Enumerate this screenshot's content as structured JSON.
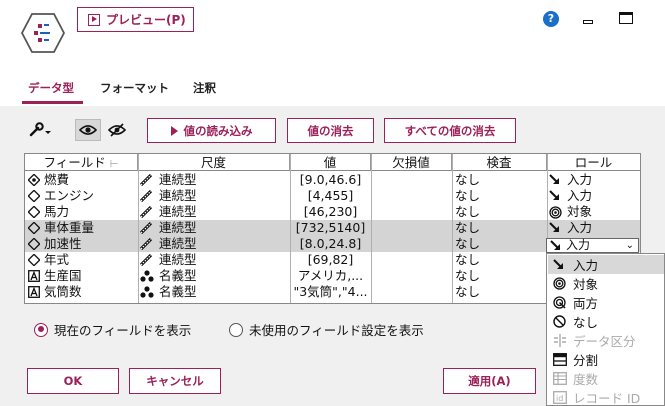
{
  "header": {
    "preview_label": "プレビュー(P)",
    "help_icon": "?"
  },
  "tabs": [
    {
      "label": "データ型",
      "active": true
    },
    {
      "label": "フォーマット",
      "active": false
    },
    {
      "label": "注釈",
      "active": false
    }
  ],
  "toolbar": {
    "read_values": "値の読み込み",
    "clear_values": "値の消去",
    "clear_all_values": "すべての値の消去"
  },
  "table": {
    "headers": [
      "フィールド",
      "尺度",
      "値",
      "欠損値",
      "検査",
      "ロール"
    ],
    "rows": [
      {
        "field": "燃費",
        "field_icon": "target-diamond-icon",
        "measure": "連続型",
        "value": "[9.0,46.6]",
        "missing": "",
        "check": "なし",
        "role": "入力"
      },
      {
        "field": "エンジン",
        "field_icon": "diamond-icon",
        "measure": "連続型",
        "value": "[4,455]",
        "missing": "",
        "check": "なし",
        "role": "入力"
      },
      {
        "field": "馬力",
        "field_icon": "diamond-icon",
        "measure": "連続型",
        "value": "[46,230]",
        "missing": "",
        "check": "なし",
        "role": "対象"
      },
      {
        "field": "車体重量",
        "field_icon": "diamond-icon",
        "measure": "連続型",
        "value": "[732,5140]",
        "missing": "",
        "check": "なし",
        "role": "入力"
      },
      {
        "field": "加速性",
        "field_icon": "diamond-icon",
        "measure": "連続型",
        "value": "[8.0,24.8]",
        "missing": "",
        "check": "なし",
        "role": "入力"
      },
      {
        "field": "年式",
        "field_icon": "diamond-icon",
        "measure": "連続型",
        "value": "[69,82]",
        "missing": "",
        "check": "なし",
        "role": ""
      },
      {
        "field": "生産国",
        "field_icon": "text-a-icon",
        "measure": "名義型",
        "value": "アメリカ,...",
        "missing": "",
        "check": "なし",
        "role": ""
      },
      {
        "field": "気筒数",
        "field_icon": "text-a-icon",
        "measure": "名義型",
        "value": "\"3気筒\",\"4...",
        "missing": "",
        "check": "なし",
        "role": ""
      }
    ]
  },
  "role_select": {
    "value": "入力"
  },
  "role_options": [
    {
      "label": "入力",
      "icon": "input-arrow-icon",
      "disabled": false
    },
    {
      "label": "対象",
      "icon": "target-icon",
      "disabled": false
    },
    {
      "label": "両方",
      "icon": "both-icon",
      "disabled": false
    },
    {
      "label": "なし",
      "icon": "none-icon",
      "disabled": false
    },
    {
      "label": "データ区分",
      "icon": "partition-icon",
      "disabled": true
    },
    {
      "label": "分割",
      "icon": "split-icon",
      "disabled": false
    },
    {
      "label": "度数",
      "icon": "frequency-icon",
      "disabled": true
    },
    {
      "label": "レコード ID",
      "icon": "record-id-icon",
      "disabled": true
    }
  ],
  "options": {
    "show_current": "現在のフィールドを表示",
    "show_unused": "未使用のフィールド設定を表示"
  },
  "footer": {
    "ok": "OK",
    "cancel": "キャンセル",
    "apply": "適用(A)"
  }
}
